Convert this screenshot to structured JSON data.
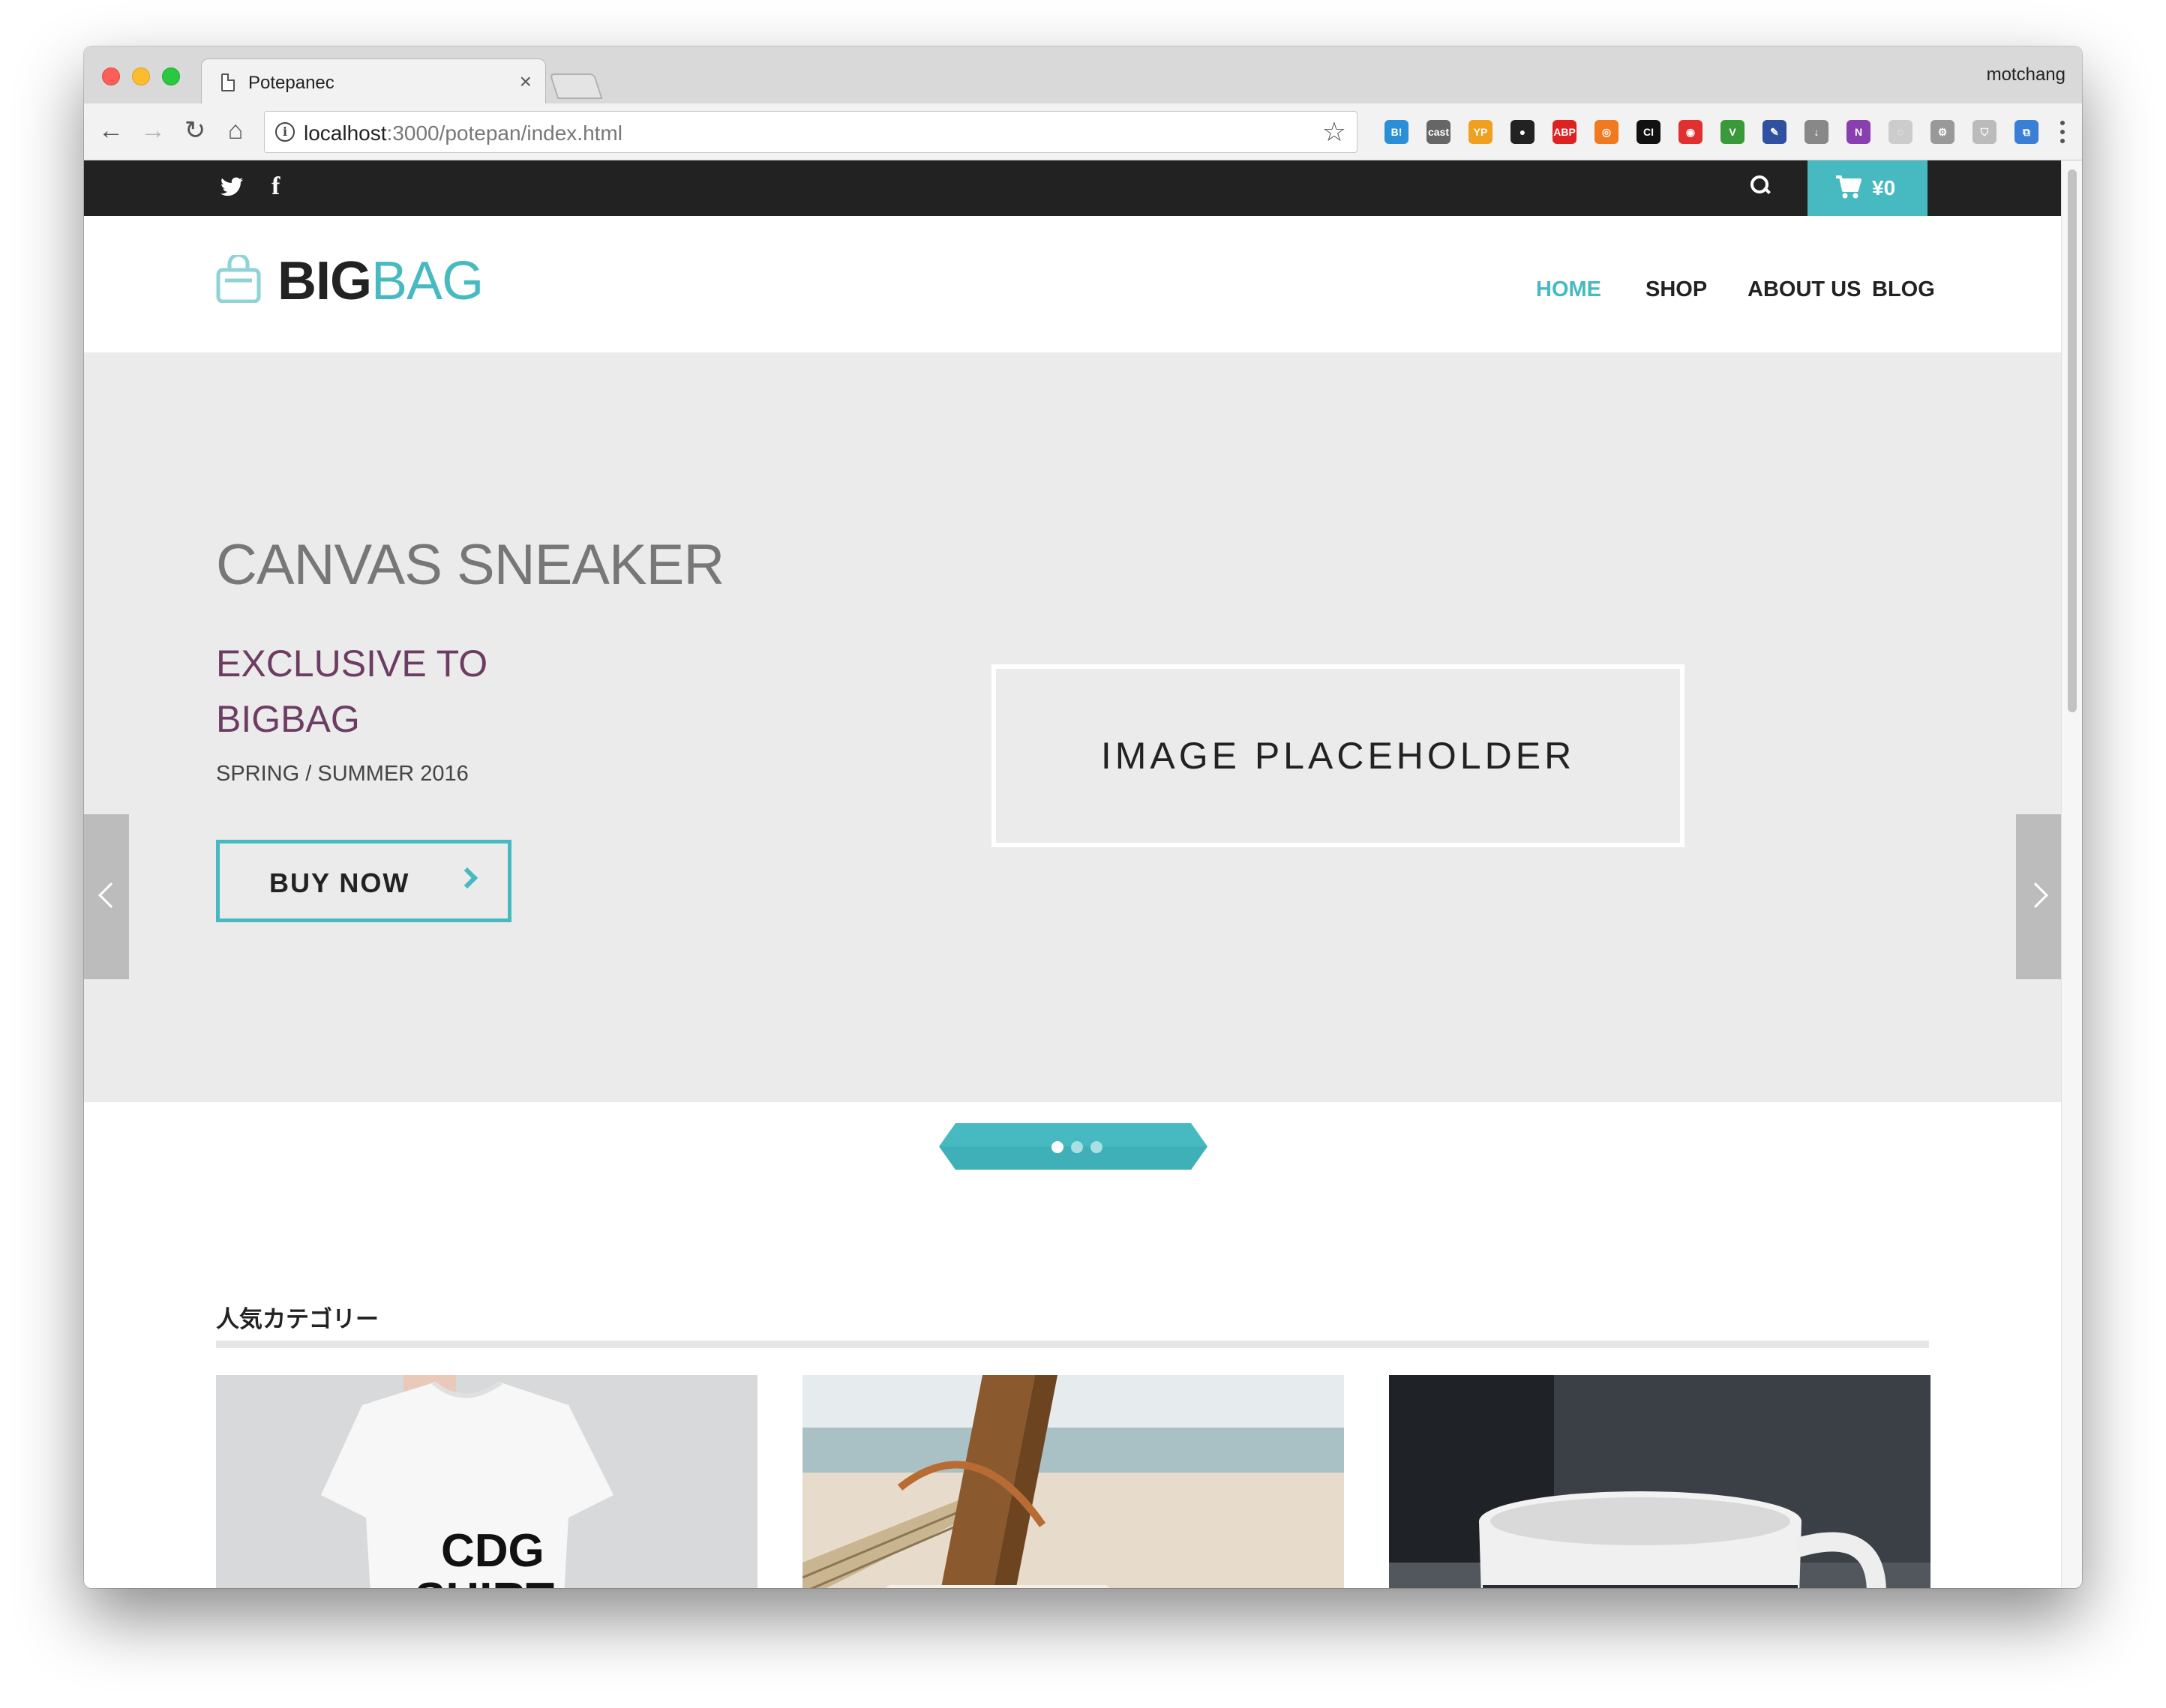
{
  "browser": {
    "tab_title": "Potepanec",
    "tab_close": "×",
    "profile_name": "motchang",
    "url_host": "localhost",
    "url_path": ":3000/potepan/index.html",
    "back": "←",
    "forward": "→",
    "reload": "↻",
    "home": "⌂",
    "star": "☆",
    "extensions": [
      "B!",
      "cast",
      "YP",
      "●",
      "ABP",
      "◎",
      "CI",
      "◉",
      "V",
      "✎",
      "↓",
      "N",
      "◌",
      "⚙",
      "⛉",
      "⧉"
    ]
  },
  "site": {
    "topbar": {
      "twitter": "🐦",
      "facebook": "f",
      "cart_total": "¥0"
    },
    "logo": {
      "big": "BIG",
      "bag": "BAG"
    },
    "nav": [
      "HOME",
      "SHOP",
      "ABOUT US",
      "BLOG"
    ],
    "nav_active": "HOME",
    "hero": {
      "title": "CANVAS SNEAKER",
      "subtitle_line1": "EXCLUSIVE TO",
      "subtitle_line2": "BIGBAG",
      "season": "SPRING / SUMMER 2016",
      "button": "BUY NOW",
      "placeholder": "IMAGE PLACEHOLDER",
      "slides": 3,
      "active_slide": 1
    },
    "categories": {
      "title": "人気カテゴリー",
      "cards": [
        "t-shirt photo",
        "beach bag photo",
        "coffee mug photo"
      ]
    }
  },
  "colors": {
    "accent": "#47bac1",
    "subtitle": "#6d3c63",
    "topbar": "#222222",
    "hero_bg": "#ebebeb"
  }
}
